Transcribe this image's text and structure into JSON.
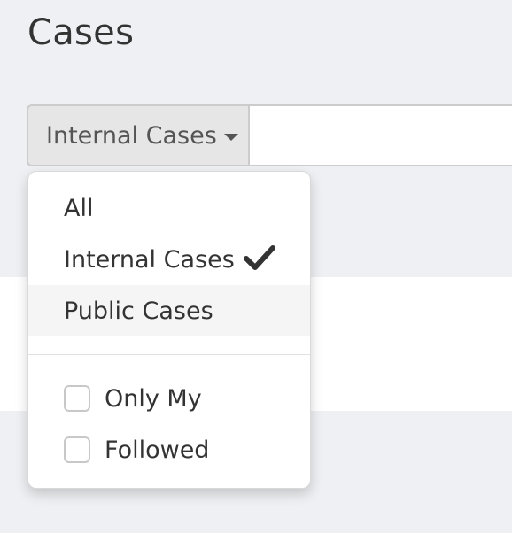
{
  "page": {
    "title": "Cases"
  },
  "filter": {
    "toggle_label": "Internal Cases",
    "search_value": "",
    "search_placeholder": ""
  },
  "dropdown": {
    "items": [
      {
        "label": "All",
        "checked": false,
        "highlighted": false
      },
      {
        "label": "Internal Cases",
        "checked": true,
        "highlighted": false
      },
      {
        "label": "Public Cases",
        "checked": false,
        "highlighted": true
      }
    ],
    "checkboxes": [
      {
        "label": "Only My",
        "checked": false
      },
      {
        "label": "Followed",
        "checked": false
      }
    ]
  },
  "icons": {
    "caret": "caret-down-icon",
    "check": "checkmark-icon"
  },
  "colors": {
    "background": "#eef0f3",
    "toggle_bg": "#e6e6e6",
    "highlight_bg": "#f5f5f5",
    "text": "#333333"
  }
}
